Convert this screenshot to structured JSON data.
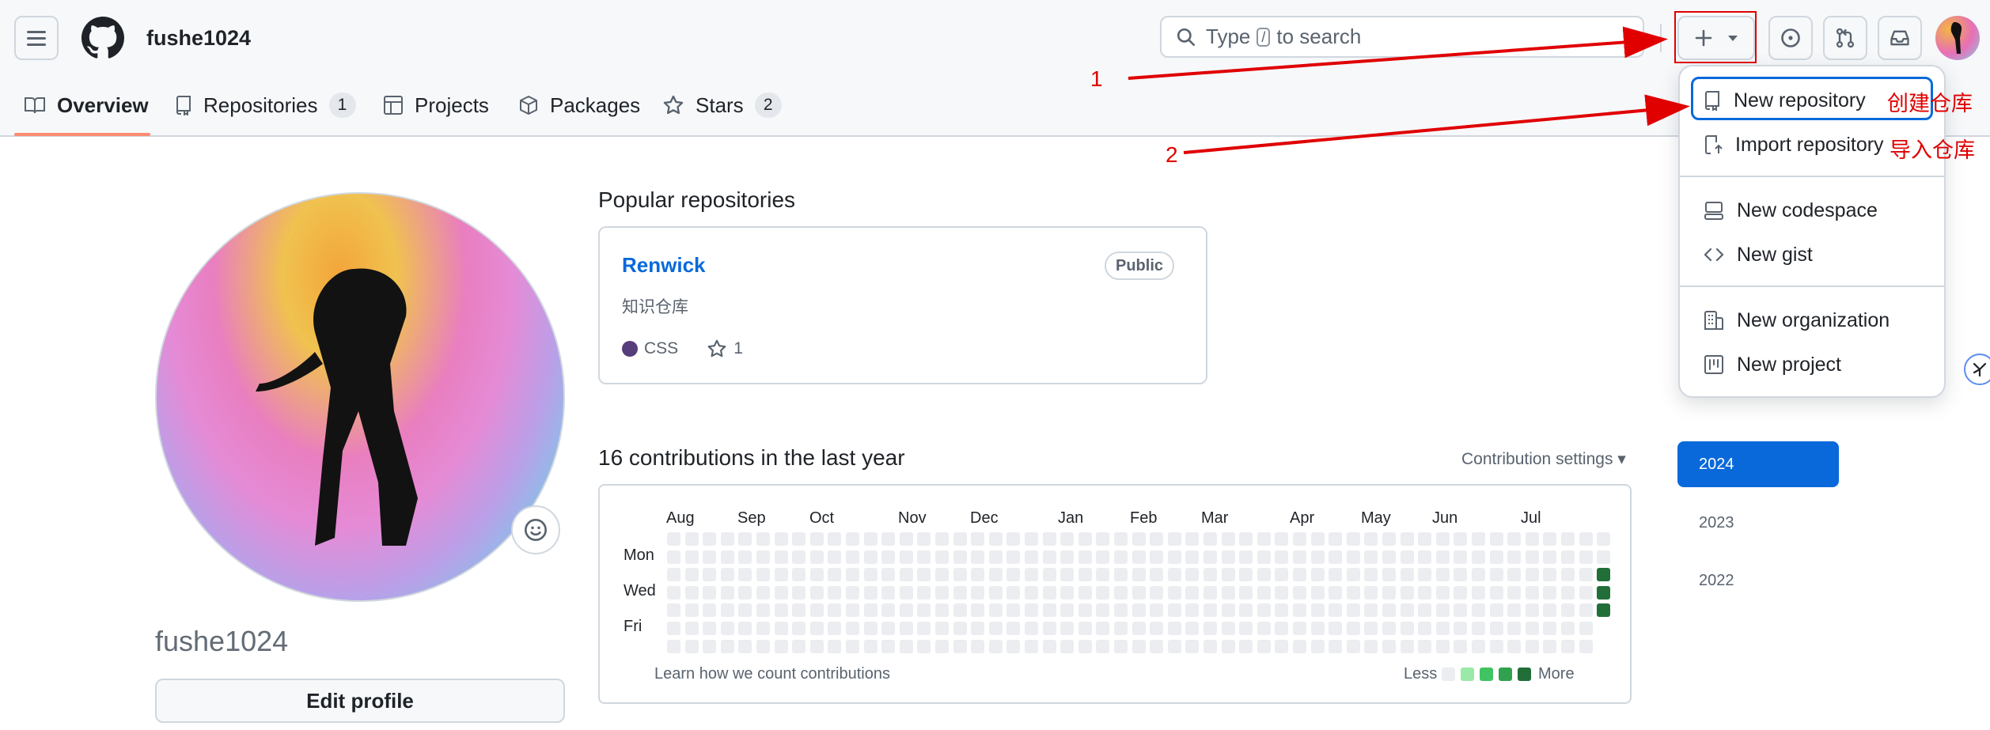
{
  "header": {
    "username": "fushe1024",
    "search_prefix": "Type",
    "search_key": "/",
    "search_suffix": "to search"
  },
  "nav": {
    "tabs": [
      {
        "label": "Overview"
      },
      {
        "label": "Repositories",
        "count": "1"
      },
      {
        "label": "Projects"
      },
      {
        "label": "Packages"
      },
      {
        "label": "Stars",
        "count": "2"
      }
    ]
  },
  "new_menu": {
    "items": [
      {
        "label": "New repository",
        "icon": "repo-icon"
      },
      {
        "label": "Import repository",
        "icon": "repo-push-icon"
      },
      {
        "label": "New codespace",
        "icon": "codespaces-icon"
      },
      {
        "label": "New gist",
        "icon": "code-icon"
      },
      {
        "label": "New organization",
        "icon": "organization-icon"
      },
      {
        "label": "New project",
        "icon": "project-icon"
      }
    ]
  },
  "annotations": {
    "num1": "1",
    "num2": "2",
    "create_repo": "创建仓库",
    "import_repo": "导入仓库",
    "color": "#e00000"
  },
  "profile": {
    "display_name": "fushe1024",
    "edit_button": "Edit profile"
  },
  "popular": {
    "title": "Popular repositories",
    "repo": {
      "name": "Renwick",
      "visibility": "Public",
      "description": "知识仓库",
      "language": "CSS",
      "language_color": "#563d7c",
      "stars": "1"
    }
  },
  "contributions": {
    "title": "16 contributions in the last year",
    "settings": "Contribution settings ▾",
    "months": [
      "Aug",
      "Sep",
      "Oct",
      "Nov",
      "Dec",
      "Jan",
      "Feb",
      "Mar",
      "Apr",
      "May",
      "Jun",
      "Jul"
    ],
    "day_labels": [
      "Mon",
      "Wed",
      "Fri"
    ],
    "learn": "Learn how we count contributions",
    "less": "Less",
    "more": "More",
    "legend_colors": [
      "#ebedf0",
      "#9be9a8",
      "#40c463",
      "#30a14e",
      "#216e39"
    ]
  },
  "years": [
    "2024",
    "2023",
    "2022"
  ],
  "colors": {
    "accent": "#0969da",
    "tab_underline": "#fd8c73",
    "border": "#d0d7de"
  }
}
